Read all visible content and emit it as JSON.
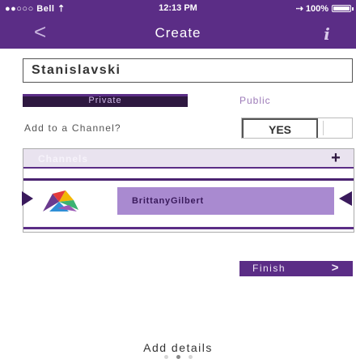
{
  "status_bar": {
    "carrier": "●●○○○ Bell ⇡",
    "time": "12:13 PM",
    "battery": "⇢ 100%"
  },
  "nav": {
    "back_glyph": "<",
    "title": "Create",
    "info_glyph": "i"
  },
  "name_field": {
    "value": "Stanislavski"
  },
  "visibility": {
    "private_label": "Private",
    "public_label": "Public",
    "selected": "Private"
  },
  "add_to_channel": {
    "label": "Add to a Channel?",
    "toggle_label": "YES"
  },
  "channels": {
    "header_title": "Channels",
    "add_glyph": "+",
    "items": [
      {
        "name": "BrittanyGilbert",
        "logo_icon": "colorful-logo-icon"
      }
    ]
  },
  "finish": {
    "label": "Finish",
    "arrow": ">"
  },
  "footer": {
    "add_details_label": "Add details",
    "page_indicator": {
      "count": 3,
      "current": 2
    }
  },
  "colors": {
    "brand_purple": "#5b2d86",
    "dark_purple": "#2e1840",
    "pill_lavender": "#a98ad0"
  }
}
